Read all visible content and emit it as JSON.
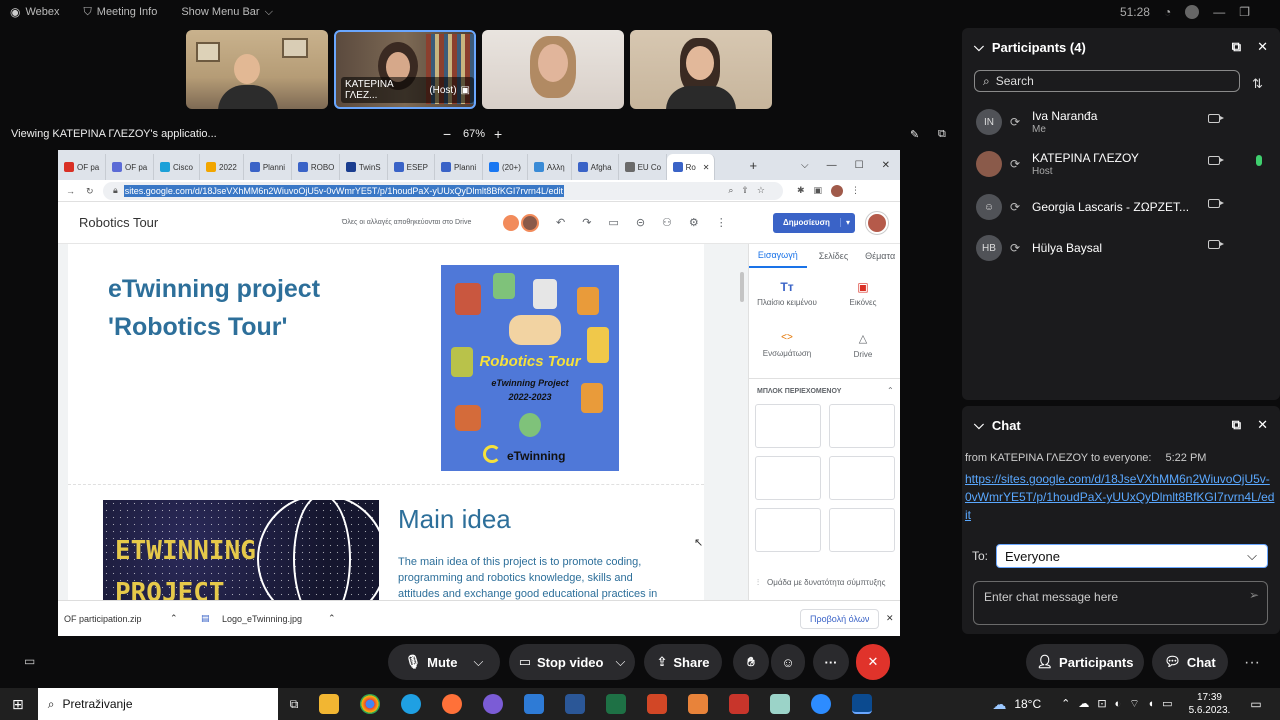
{
  "app": {
    "name": "Webex",
    "meeting_info": "Meeting Info",
    "show_menu": "Show Menu Bar",
    "clock": "51:28"
  },
  "thumbnails": [
    {
      "name": ""
    },
    {
      "name": "ΚΑΤΕΡΙΝΑ ΓΛΕΖ...",
      "tag": "(Host)"
    },
    {
      "name": ""
    },
    {
      "name": ""
    }
  ],
  "viewing": {
    "text": "Viewing ΚΑΤΕΡΙΝΑ ΓΛΕΖΟΥ's applicatio...",
    "zoom": "67%",
    "minus": "−",
    "plus": "+"
  },
  "browser": {
    "tabs": [
      "OF pa",
      "OF pa",
      "Cisco",
      "2022",
      "Planni",
      "ROBO",
      "TwinS",
      "ESEP",
      "Planni",
      "(20+)",
      "Αλλη",
      "Afgha",
      "EU Co",
      "Ro"
    ],
    "url": "sites.google.com/d/18JseVXhMM6n2WiuvoOjU5v-0vWmrYE5T/p/1houdPaX-yUUxQyDlmlt8BfKGI7rvrn4L/edit"
  },
  "sites": {
    "title": "Robotics Tour",
    "saved": "Όλες οι αλλαγές αποθηκεύονται στο Drive",
    "publish": "Δημοσίευση",
    "heading_line1": "eTwinning project",
    "heading_line2": "'Robotics Tour'",
    "poster_title": "Robotics Tour",
    "poster_sub1": "eTwinning Project",
    "poster_sub2": "2022-2023",
    "poster_brand": "eTwinning",
    "image_text1": "ETWINNING",
    "image_text2": "PROJECT",
    "main_idea": "Main idea",
    "main_text": "The main idea of this project is to promote coding, programming and robotics knowledge, skills and attitudes and exchange good educational practices in"
  },
  "side_panel": {
    "tabs": [
      "Εισαγωγή",
      "Σελίδες",
      "Θέματα"
    ],
    "text_box": "Πλαίσιο κειμένου",
    "images": "Εικόνες",
    "embed": "Ενσωμάτωση",
    "drive": "Drive",
    "blocks": "ΜΠΛΟΚ ΠΕΡΙΕΧΟΜΕΝΟΥ",
    "group": "Ομάδα με δυνατότητα σύμπτυξης"
  },
  "downloads": {
    "file1": "OF participation.zip",
    "file2": "Logo_eTwinning.jpg",
    "show_all": "Προβολή όλων"
  },
  "participants": {
    "title": "Participants (4)",
    "search_placeholder": "Search",
    "list": [
      {
        "initials": "IN",
        "name": "Iva Naranđa",
        "sub": "Me"
      },
      {
        "initials": "",
        "name": "ΚΑΤΕΡΙΝΑ ΓΛΕΖΟΥ",
        "sub": "Host"
      },
      {
        "initials": "",
        "name": "Georgia Lascaris - ΖΩΡΖΕΤ...",
        "sub": ""
      },
      {
        "initials": "HB",
        "name": "Hülya Baysal",
        "sub": ""
      }
    ]
  },
  "chat": {
    "title": "Chat",
    "from": "from ΚΑΤΕΡΙΝΑ ΓΛΕΖΟΥ to everyone:",
    "time": "5:22 PM",
    "link": "https://sites.google.com/d/18JseVXhMM6n2WiuvoOjU5v-0vWmrYE5T/p/1houdPaX-yUUxQyDlmlt8BfKGI7rvrn4L/edit",
    "to_label": "To:",
    "to_value": "Everyone",
    "placeholder": "Enter chat message here"
  },
  "controls": {
    "mute": "Mute",
    "stop_video": "Stop video",
    "share": "Share",
    "more": "···",
    "participants": "Participants",
    "chat": "Chat"
  },
  "taskbar": {
    "search": "Pretraživanje",
    "temp": "18°C",
    "time": "17:39",
    "date": "5.6.2023."
  }
}
